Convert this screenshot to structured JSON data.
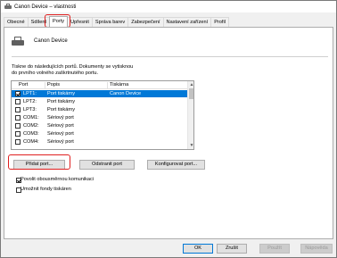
{
  "window": {
    "title": "Canon Device – vlastnosti"
  },
  "tabs": [
    {
      "label": "Obecné"
    },
    {
      "label": "Sdílení"
    },
    {
      "label": "Porty"
    },
    {
      "label": "Upřesnit"
    },
    {
      "label": "Správa barev"
    },
    {
      "label": "Zabezpečení"
    },
    {
      "label": "Nastavení zařízení"
    },
    {
      "label": "Profil"
    }
  ],
  "device": {
    "name": "Canon Device"
  },
  "ports_description": "Tiskne do následujících portů. Dokumenty se vytisknou do prvního volného zaškrtnutého portu.",
  "port_list": {
    "columns": {
      "port": "Port",
      "description": "Popis",
      "printer": "Tiskárna"
    },
    "rows": [
      {
        "port": "LPT1:",
        "description": "Port tiskárny",
        "printer": "Canon Device",
        "checked": true,
        "selected": true
      },
      {
        "port": "LPT2:",
        "description": "Port tiskárny",
        "printer": "",
        "checked": false,
        "selected": false
      },
      {
        "port": "LPT3:",
        "description": "Port tiskárny",
        "printer": "",
        "checked": false,
        "selected": false
      },
      {
        "port": "COM1:",
        "description": "Sériový port",
        "printer": "",
        "checked": false,
        "selected": false
      },
      {
        "port": "COM2:",
        "description": "Sériový port",
        "printer": "",
        "checked": false,
        "selected": false
      },
      {
        "port": "COM3:",
        "description": "Sériový port",
        "printer": "",
        "checked": false,
        "selected": false
      },
      {
        "port": "COM4:",
        "description": "Sériový port",
        "printer": "",
        "checked": false,
        "selected": false
      }
    ]
  },
  "buttons": {
    "add_port": "Přidat port...",
    "delete_port": "Odstranit port",
    "configure_port": "Konfigurovat port..."
  },
  "options": {
    "bidirectional": {
      "label": "Povolit obousměrnou komunikaci",
      "checked": true
    },
    "pooling": {
      "label": "Umožnit fondy tiskáren",
      "checked": false
    }
  },
  "dialog_buttons": {
    "ok": "OK",
    "cancel": "Zrušit",
    "apply": "Použít",
    "help": "Nápověda"
  },
  "colors": {
    "selection": "#0078d7",
    "highlight": "#e02020"
  }
}
